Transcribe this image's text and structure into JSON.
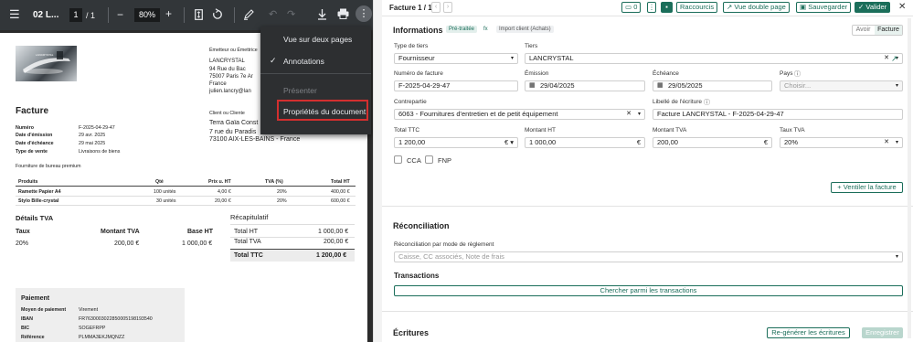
{
  "pdf_viewer": {
    "title": "02 L...",
    "current_page": "1",
    "page_sep": "/ 1",
    "zoom": "80%",
    "icons": [
      "menu-icon",
      "minus-icon",
      "plus-icon",
      "fit-page-icon",
      "rotate-icon",
      "annotate-icon",
      "undo-icon",
      "redo-icon",
      "download-icon",
      "print-icon",
      "more-vert-icon"
    ],
    "menu": {
      "items": [
        {
          "label": "Vue sur deux pages",
          "checked": false
        },
        {
          "label": "Annotations",
          "checked": true
        },
        {
          "label": "Présenter",
          "disabled": true
        },
        {
          "label": "Propriétés du document",
          "highlighted": true
        }
      ]
    }
  },
  "invoice_doc": {
    "logo_text": "LANCRYSTAL",
    "issuer_label": "Émetteur ou Émettrice",
    "issuer_name": "LANCRYSTAL",
    "issuer_addr1": "94 Rue du Bac",
    "issuer_addr2": "75007 Paris 7e Ar",
    "issuer_country": "France",
    "issuer_email": "julien.lancry@lan",
    "title": "Facture",
    "client_label": "Client ou Cliente",
    "client_name": "Terra Gaïa Const",
    "client_addr1": "7 rue du Paradis",
    "client_addr2": "73100 AIX-LES-BAINS - France",
    "meta": [
      {
        "k": "Numéro",
        "v": "F-2025-04-29-47"
      },
      {
        "k": "Date d'émission",
        "v": "29 avr. 2025"
      },
      {
        "k": "Date d'échéance",
        "v": "29 mai 2025"
      },
      {
        "k": "Type de vente",
        "v": "Livraisons de biens"
      }
    ],
    "description": "Fourniture de bureau premium",
    "table_headers": [
      "Produits",
      "Qté",
      "Prix u. HT",
      "TVA (%)",
      "Total HT"
    ],
    "rows": [
      [
        "Ramette Papier A4",
        "100 unités",
        "4,00 €",
        "20%",
        "400,00 €"
      ],
      [
        "Stylo Bille-crystal",
        "30 unités",
        "20,00 €",
        "20%",
        "600,00 €"
      ]
    ],
    "vat_title": "Détails TVA",
    "vat_headers": [
      "Taux",
      "Montant TVA",
      "Base HT"
    ],
    "vat_row": [
      "20%",
      "200,00 €",
      "1 000,00 €"
    ],
    "summary_title": "Récapitulatif",
    "summary": [
      {
        "k": "Total HT",
        "v": "1 000,00 €"
      },
      {
        "k": "Total TVA",
        "v": "200,00 €"
      },
      {
        "k": "Total TTC",
        "v": "1 200,00 €"
      }
    ],
    "payment_title": "Paiement",
    "payment": [
      {
        "k": "Moyen de paiement",
        "v": "Virement"
      },
      {
        "k": "IBAN",
        "v": "FR7630003022850005198193540"
      },
      {
        "k": "BIC",
        "v": "SOGEFRPP"
      },
      {
        "k": "Référence",
        "v": "PLMMA3EKJMQNZZ"
      }
    ]
  },
  "form": {
    "header": {
      "title": "Facture 1 / 1",
      "comments_count": "0",
      "shortcuts": "Raccourcis",
      "double_page": "Vue double page",
      "save": "Sauvegarder",
      "validate": "Valider"
    },
    "info_title": "Informations",
    "badge_pretreated": "Pré-traitée",
    "badge_fx": "fx",
    "badge_import": "Import client (Achats)",
    "toggle_avoir": "Avoir",
    "toggle_facture": "Facture",
    "labels": {
      "type_tiers": "Type de tiers",
      "tiers": "Tiers",
      "numero": "Numéro de facture",
      "emission": "Émission",
      "echeance": "Échéance",
      "pays": "Pays",
      "contrepartie": "Contrepartie",
      "libelle": "Libellé de l'écriture",
      "total_ttc": "Total TTC",
      "montant_ht": "Montant HT",
      "montant_tva": "Montant TVA",
      "taux_tva": "Taux TVA"
    },
    "values": {
      "type_tiers": "Fournisseur",
      "tiers": "LANCRYSTAL",
      "numero": "F-2025-04-29-47",
      "emission": "29/04/2025",
      "echeance": "29/05/2025",
      "pays_placeholder": "Choisir...",
      "contrepartie": "6063 - Fournitures d'entretien et de petit équipement",
      "libelle": "Facture LANCRYSTAL - F-2025-04-29-47",
      "total_ttc": "1 200,00",
      "total_ttc_currency": "€",
      "montant_ht": "1 000,00",
      "montant_ht_currency": "€",
      "montant_tva": "200,00",
      "montant_tva_currency": "€",
      "taux_tva": "20%"
    },
    "cca": "CCA",
    "fnp": "FNP",
    "ventiler": "+ Ventiler la facture",
    "reconciliation_title": "Réconciliation",
    "reconciliation_label": "Réconciliation par mode de règlement",
    "reconciliation_placeholder": "Caisse, CC associés, Note de frais",
    "transactions_title": "Transactions",
    "search_transactions": "Chercher parmi les transactions",
    "ecritures_title": "Écritures",
    "regenerate": "Re-générer les écritures",
    "register": "Enregistrer"
  },
  "colors": {
    "accent": "#1b6e5a",
    "menu_highlight": "#d32f2f",
    "viewer_bg": "#323639"
  }
}
